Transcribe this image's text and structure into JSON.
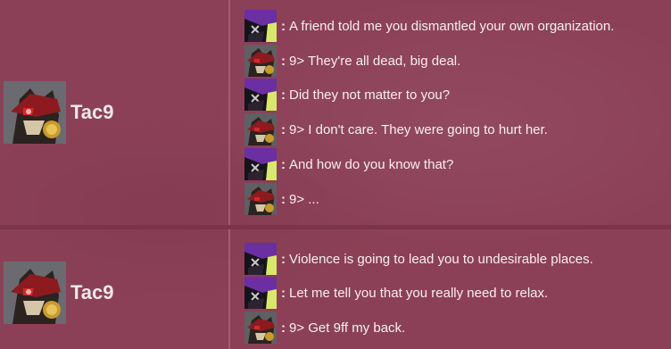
{
  "colors": {
    "background": "#8c4057",
    "separator": "#7b3449",
    "text": "#f7eef1",
    "name_text": "#f1e6ea"
  },
  "blocks": [
    {
      "speaker": {
        "name": "Tac9",
        "avatar_icon": "tac9-wolf-avatar"
      },
      "lines": [
        {
          "icon": "purple-character-icon",
          "text": "A friend told me you dismantled your own organization."
        },
        {
          "icon": "tac9-wolf-icon",
          "text": "9> They're all dead, big deal."
        },
        {
          "icon": "purple-character-icon",
          "text": "Did they not matter to you?"
        },
        {
          "icon": "tac9-wolf-icon",
          "text": "9> I don't care. They were going to hurt her."
        },
        {
          "icon": "purple-character-icon",
          "text": "And how do you know that?"
        },
        {
          "icon": "tac9-wolf-icon",
          "text": "9> ..."
        }
      ]
    },
    {
      "speaker": {
        "name": "Tac9",
        "avatar_icon": "tac9-wolf-avatar"
      },
      "lines": [
        {
          "icon": "purple-character-icon",
          "text": "Violence is going to lead you to undesirable places."
        },
        {
          "icon": "purple-character-icon",
          "text": "Let me tell you that you really need to relax."
        },
        {
          "icon": "tac9-wolf-icon",
          "text": "9> Get 9ff my back."
        }
      ]
    }
  ]
}
